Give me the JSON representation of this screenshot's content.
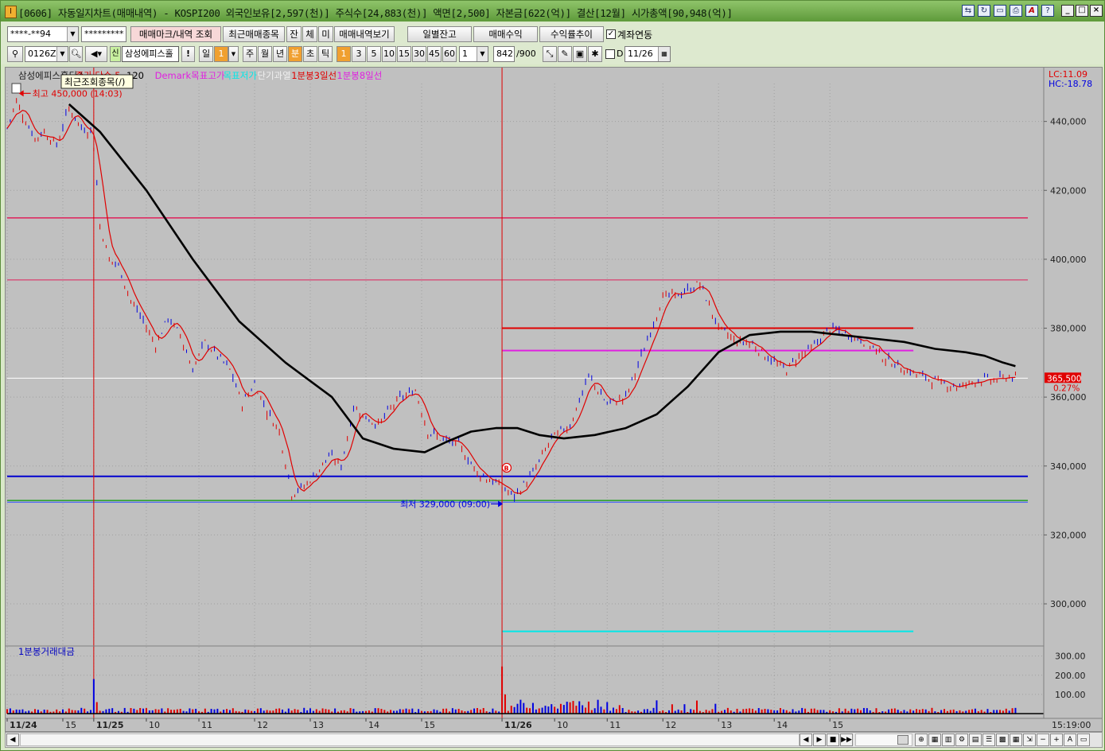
{
  "window": {
    "title": "[0606] 자동일지차트(매매내역) - KOSPI200 외국인보유[2,597(천)] 주식수[24,883(천)] 액면[2,500] 자본금[622(억)] 결산[12월] 시가총액[90,948(억)]",
    "app_icon": "I"
  },
  "toolbar1": {
    "account": "****-**94",
    "password": "*********",
    "btn_mark": "매매마크/내역 조회",
    "btn_recent": "최근매매종목",
    "btn_jan": "잔",
    "btn_che": "체",
    "btn_mi": "미",
    "btn_history": "매매내역보기",
    "btn_daily": "일별잔고",
    "btn_profit": "매매수익",
    "btn_return": "수익률추이",
    "link_label": "계좌연동",
    "link_checked": "✓"
  },
  "toolbar2": {
    "code": "0126Z0",
    "sin": "신",
    "name": "삼성에피스홀",
    "excl": "!",
    "period_il": "일",
    "period_num": "1",
    "ju": "주",
    "wol": "월",
    "nyeon": "년",
    "bun": "분",
    "cho": "초",
    "tik": "틱",
    "intervals": [
      "1",
      "3",
      "5",
      "10",
      "15",
      "30",
      "45",
      "60"
    ],
    "count": "1",
    "bars_shown": "842",
    "bars_total": "/900",
    "d_label": "D",
    "date": "11/26"
  },
  "chart_data": {
    "type": "line",
    "price_legend": [
      {
        "text": "삼성에피스홀딩스",
        "color": "#202020"
      },
      {
        "text": "종가 단순 5",
        "color": "#e00000"
      },
      {
        "text": "120",
        "color": "#000000"
      },
      {
        "text": "Demark목표고가",
        "color": "#e020e0"
      },
      {
        "text": "목표저가",
        "color": "#00e8e8"
      },
      {
        "text": "단기과열",
        "color": "#f0f0f0"
      },
      {
        "text": "1분봉3일선",
        "color": "#e00000"
      },
      {
        "text": "1분봉8일선",
        "color": "#e020e0"
      }
    ],
    "tooltip": "최근조회종목(/)",
    "high_label": "최고 450,000 (14:03)",
    "low_label": "최저 329,000 (09:00)",
    "lc_label": "LC:11.09",
    "hc_label": "HC:-18.78",
    "current_price": "365,500",
    "current_change": "0.27%",
    "buy_marker": "B",
    "y_ticks": [
      "440,000",
      "420,000",
      "400,000",
      "380,000",
      "360,000",
      "340,000",
      "320,000",
      "300,000"
    ],
    "y_tick_values": [
      440000,
      420000,
      400000,
      380000,
      360000,
      340000,
      320000,
      300000
    ],
    "ylim": [
      288000,
      451000
    ],
    "volume_label": "1분봉거래대금",
    "volume_ticks": [
      "300.00",
      "200.00",
      "100.00"
    ],
    "volume_tick_values": [
      300,
      200,
      100
    ],
    "volume_ylim": [
      0,
      340
    ],
    "x_labels": [
      "11/24",
      "15",
      "11/25",
      "10",
      "11",
      "12",
      "13",
      "14",
      "15",
      "11/26",
      "10",
      "11",
      "12",
      "13",
      "14",
      "15"
    ],
    "x_label_bold": [
      true,
      false,
      true,
      false,
      false,
      false,
      false,
      false,
      false,
      true,
      false,
      false,
      false,
      false,
      false,
      false
    ],
    "time_label": "15:19:00",
    "price_key_x": [
      0,
      3,
      6,
      9,
      12,
      16,
      20,
      24,
      27,
      28,
      30,
      33,
      36,
      40,
      44,
      48,
      52,
      56,
      60,
      64,
      68,
      72,
      76,
      80,
      84,
      88,
      92,
      96,
      100,
      104,
      108,
      112,
      116,
      120,
      126,
      132,
      136,
      140,
      146,
      152,
      158,
      164,
      170,
      176,
      182,
      188,
      194,
      200,
      206,
      212,
      218,
      224,
      230,
      236,
      240,
      244,
      248,
      252,
      256,
      260,
      266,
      272,
      278,
      284,
      290,
      296,
      302,
      308,
      314,
      320,
      324,
      326
    ],
    "price_key_y": [
      438000,
      446000,
      440000,
      435000,
      437000,
      433000,
      444000,
      438000,
      437000,
      433000,
      410000,
      400000,
      398000,
      388000,
      382000,
      375000,
      383000,
      378000,
      368000,
      376000,
      372000,
      368000,
      358000,
      364000,
      356000,
      350000,
      332000,
      334000,
      338000,
      343000,
      340000,
      357000,
      354000,
      352000,
      359000,
      362000,
      350000,
      348000,
      346000,
      338000,
      335000,
      331000,
      338000,
      348000,
      352000,
      366000,
      358000,
      360000,
      374000,
      389000,
      390000,
      393000,
      380000,
      376000,
      376000,
      373000,
      370000,
      368000,
      372000,
      374000,
      380000,
      378000,
      376000,
      371000,
      368000,
      366000,
      364000,
      363000,
      365000,
      365000,
      366000,
      365500
    ],
    "total_x": 330,
    "session_starts": [
      28,
      160
    ],
    "ma120_x": [
      20,
      30,
      45,
      60,
      75,
      90,
      105,
      115,
      125,
      135,
      142,
      150,
      158,
      165,
      172,
      180,
      190,
      200,
      210,
      220,
      230,
      240,
      250,
      260,
      270,
      280,
      290,
      300,
      310,
      316,
      322,
      326
    ],
    "ma120_y": [
      445000,
      437000,
      420000,
      400000,
      382000,
      370000,
      360000,
      348000,
      345000,
      344000,
      347000,
      350000,
      351000,
      351000,
      349000,
      348000,
      349000,
      351000,
      355000,
      363000,
      373000,
      378000,
      379000,
      379000,
      378000,
      377000,
      376000,
      374000,
      373000,
      372000,
      370000,
      369000
    ],
    "hlines": [
      {
        "y": 412000,
        "color": "#e0205a",
        "width": 1.5,
        "from": 0,
        "to": 330
      },
      {
        "y": 394000,
        "color": "#e0205a",
        "width": 1,
        "from": 0,
        "to": 330
      },
      {
        "y": 337000,
        "color": "#0000d0",
        "width": 2,
        "from": 0,
        "to": 330
      },
      {
        "y": 330000,
        "color": "#20a020",
        "width": 1.5,
        "from": 0,
        "to": 330
      },
      {
        "y": 329500,
        "color": "#3050ff",
        "width": 1,
        "from": 0,
        "to": 330
      },
      {
        "y": 380000,
        "color": "#e00000",
        "width": 2,
        "from": 160,
        "to": 293
      },
      {
        "y": 373500,
        "color": "#e020e0",
        "width": 2,
        "from": 160,
        "to": 293
      },
      {
        "y": 292000,
        "color": "#00e8e8",
        "width": 2,
        "from": 160,
        "to": 293
      },
      {
        "y": 365500,
        "color": "#ffffff",
        "width": 1,
        "from": 0,
        "to": 330
      }
    ],
    "vlines": [
      28,
      160
    ],
    "colors": {
      "bg": "#c0c0c0",
      "up": "#e00000",
      "down": "#0000e0",
      "ma5": "#e00000",
      "ma120": "#000000",
      "grid": "#a0a0a0",
      "axis_text": "#202020"
    }
  },
  "scrollbar": {
    "left_arrow": "◀",
    "controls": [
      "◀",
      "▶",
      "■",
      "▶▶"
    ],
    "zoom": [
      "−",
      "+",
      "A"
    ]
  }
}
